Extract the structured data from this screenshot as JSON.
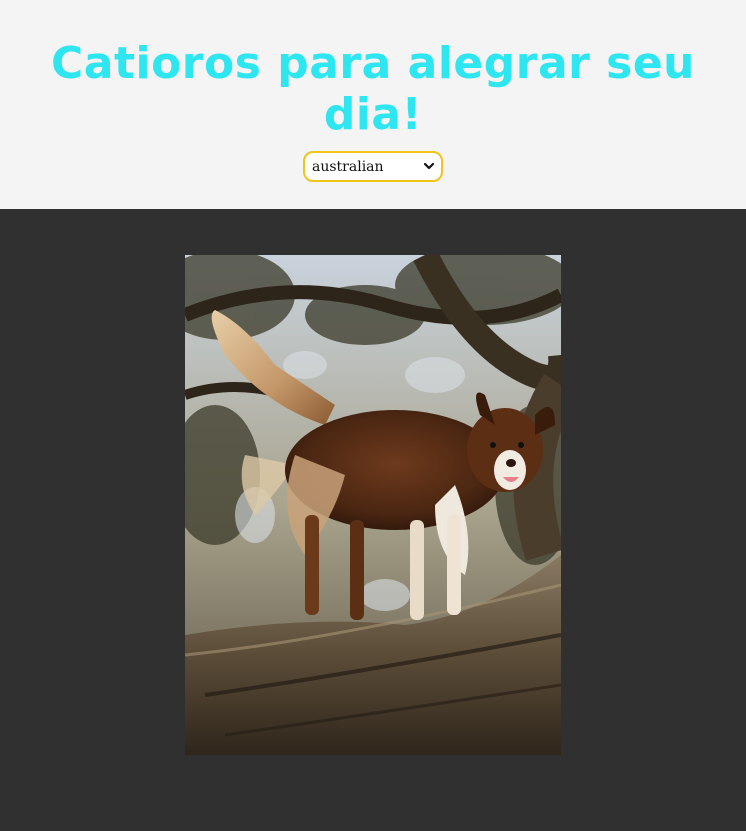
{
  "header": {
    "title": "Catioros para alegrar seu dia!",
    "title_color": "#2ee6f0",
    "background": "#f4f4f4"
  },
  "breed_select": {
    "selected": "australian",
    "border_color": "#f0c419",
    "icon": "chevron-down-icon"
  },
  "main": {
    "background": "#303030",
    "image": {
      "subject": "dog photo"
    }
  }
}
